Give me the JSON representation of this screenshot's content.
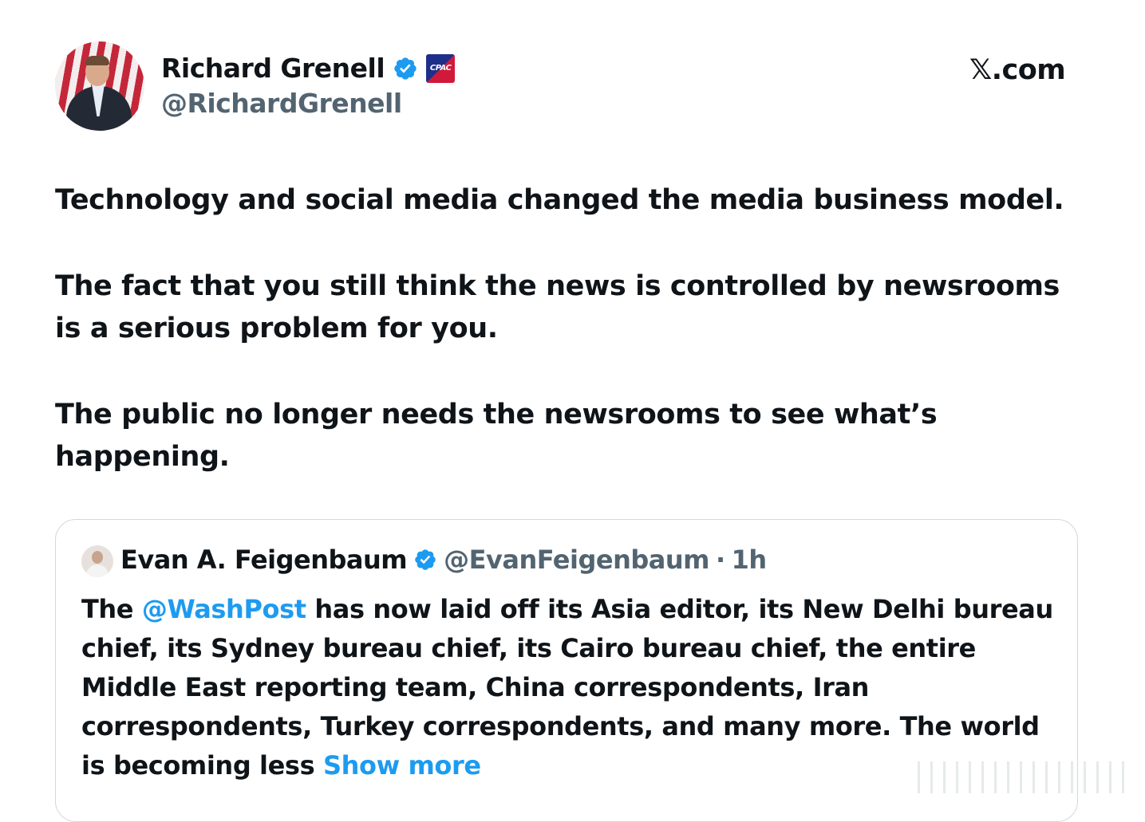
{
  "author": {
    "name": "Richard Grenell",
    "handle": "@RichardGrenell",
    "affiliation_badge": "CPAC",
    "verified_color": "#1d9bf0"
  },
  "site_label": "𝕏.com",
  "post": {
    "paragraphs": [
      "Technology and social media changed the media business model.",
      "The fact that you still think the news is controlled by newsrooms is a serious problem for you.",
      "The public no longer needs the newsrooms to see what’s happening."
    ]
  },
  "quoted": {
    "name": "Evan A. Feigenbaum",
    "handle": "@EvanFeigenbaum",
    "separator": "·",
    "time": "1h",
    "text_before_mention": "The ",
    "mention": "@WashPost",
    "text_after_mention": " has now laid off its Asia editor, its New Delhi bureau chief, its Sydney bureau chief, its Cairo bureau chief, the entire Middle East reporting team, China correspondents, Iran correspondents, Turkey correspondents, and many more. The world is becoming less ",
    "show_more": "Show more",
    "link_color": "#1d9bf0"
  }
}
